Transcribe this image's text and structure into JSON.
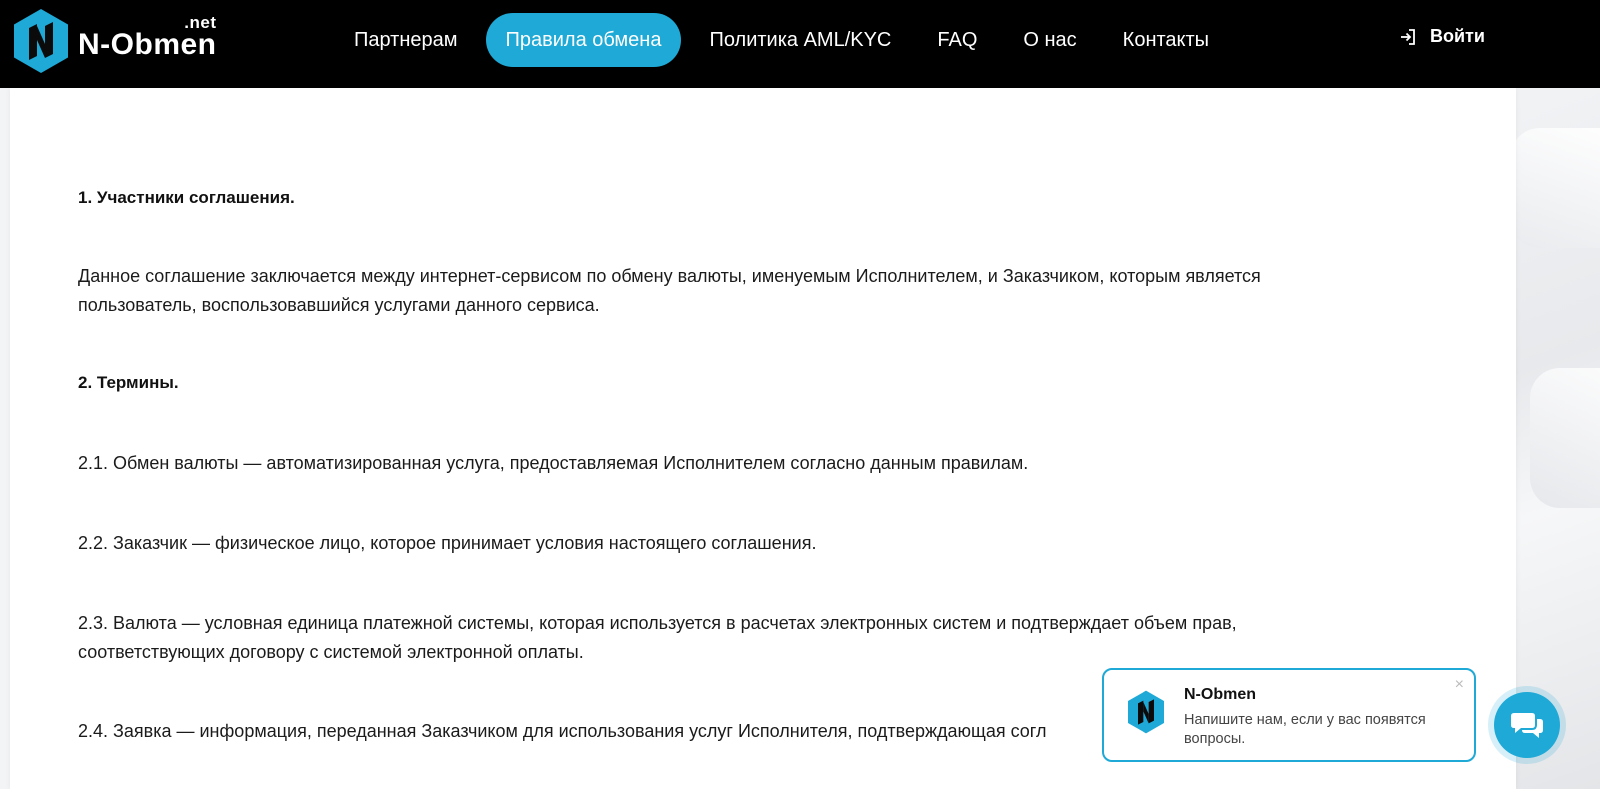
{
  "header": {
    "logo": {
      "name": "N-Obmen",
      "tld": ".net"
    },
    "nav": [
      {
        "label": "Партнерам",
        "active": false
      },
      {
        "label": "Правила обмена",
        "active": true
      },
      {
        "label": "Политика AML/KYC",
        "active": false
      },
      {
        "label": "FAQ",
        "active": false
      },
      {
        "label": "О нас",
        "active": false
      },
      {
        "label": "Контакты",
        "active": false
      }
    ],
    "login_label": "Войти"
  },
  "content": {
    "section1_title": "1. Участники соглашения.",
    "section1_text": "Данное соглашение заключается между интернет-сервисом по обмену валюты, именуемым Исполнителем, и Заказчиком, которым является пользователь, воспользовавшийся услугами данного сервиса.",
    "section2_title": "2. Термины.",
    "term_2_1": "2.1. Обмен валюты — автоматизированная услуга, предоставляемая Исполнителем согласно данным правилам.",
    "term_2_2": "2.2. Заказчик — физическое лицо, которое принимает условия настоящего соглашения.",
    "term_2_3": "2.3. Валюта — условная единица платежной системы, которая используется в расчетах электронных систем и подтверждает объем прав, соответствующих договору с системой электронной оплаты.",
    "term_2_4": "2.4. Заявка — информация, переданная Заказчиком для использования услуг Исполнителя, подтверждающая согл"
  },
  "chat": {
    "name": "N-Obmen",
    "message": "Напишите нам, если у вас появятся вопросы.",
    "close_glyph": "×"
  },
  "colors": {
    "header_bg": "#000000",
    "accent": "#1ea9d6",
    "text": "#1b1b1b"
  },
  "icons": {
    "logo": "n-hexagon-logo-icon",
    "login": "login-arrow-icon",
    "chat_avatar": "n-hexagon-logo-icon",
    "chat_button": "chat-bubbles-icon",
    "close": "close-icon"
  }
}
